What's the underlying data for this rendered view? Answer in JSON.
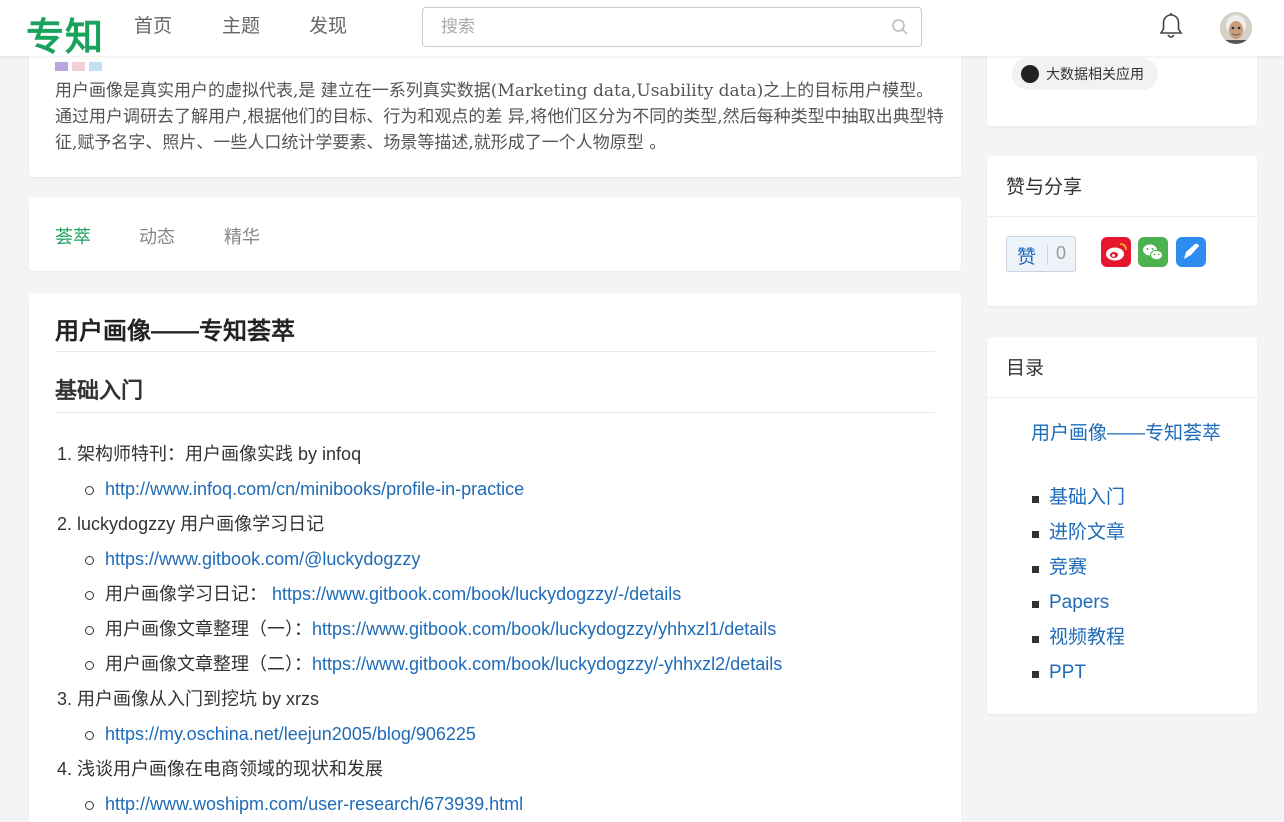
{
  "header": {
    "logo": "专知",
    "nav": [
      "首页",
      "主题",
      "发现"
    ],
    "search_placeholder": "搜索"
  },
  "intro": {
    "text": "用户画像是真实用户的虚拟代表,是 建立在一系列真实数据(Marketing data,Usability data)之上的目标用户模型。通过用户调研去了解用户,根据他们的目标、行为和观点的差 异,将他们区分为不同的类型,然后每种类型中抽取出典型特征,赋予名字、照片、一些人口统计学要素、场景等描述,就形成了一个人物原型 。"
  },
  "tabs": [
    "荟萃",
    "动态",
    "精华"
  ],
  "content": {
    "title": "用户画像——专知荟萃",
    "section": "基础入门",
    "items": [
      {
        "num": "1.",
        "title": "架构师特刊：用户画像实践 by infoq",
        "subs": [
          {
            "prefix": "",
            "link": "http://www.infoq.com/cn/minibooks/profile-in-practice"
          }
        ]
      },
      {
        "num": "2.",
        "title": "luckydogzzy 用户画像学习日记",
        "subs": [
          {
            "prefix": "",
            "link": "https://www.gitbook.com/@luckydogzzy"
          },
          {
            "prefix": "用户画像学习日记： ",
            "link": "https://www.gitbook.com/book/luckydogzzy/-/details"
          },
          {
            "prefix": "用户画像文章整理（一）：",
            "link": "https://www.gitbook.com/book/luckydogzzy/yhhxzl1/details"
          },
          {
            "prefix": "用户画像文章整理（二）：",
            "link": "https://www.gitbook.com/book/luckydogzzy/-yhhxzl2/details"
          }
        ]
      },
      {
        "num": "3.",
        "title": "用户画像从入门到挖坑 by xrzs",
        "subs": [
          {
            "prefix": "",
            "link": "https://my.oschina.net/leejun2005/blog/906225"
          }
        ]
      },
      {
        "num": "4.",
        "title": "浅谈用户画像在电商领域的现状和发展",
        "subs": [
          {
            "prefix": "",
            "link": "http://www.woshipm.com/user-research/673939.html"
          }
        ]
      }
    ]
  },
  "sidebar": {
    "tag": "大数据相关应用",
    "share": {
      "title": "赞与分享",
      "like_label": "赞",
      "like_count": "0",
      "colors": {
        "weibo": "#e6162d",
        "wechat": "#4cb14f",
        "other": "#2d8cf0"
      }
    },
    "toc": {
      "title": "目录",
      "main": "用户画像——专知荟萃",
      "items": [
        "基础入门",
        "进阶文章",
        "竞赛",
        "Papers",
        "视频教程",
        "PPT"
      ]
    }
  }
}
